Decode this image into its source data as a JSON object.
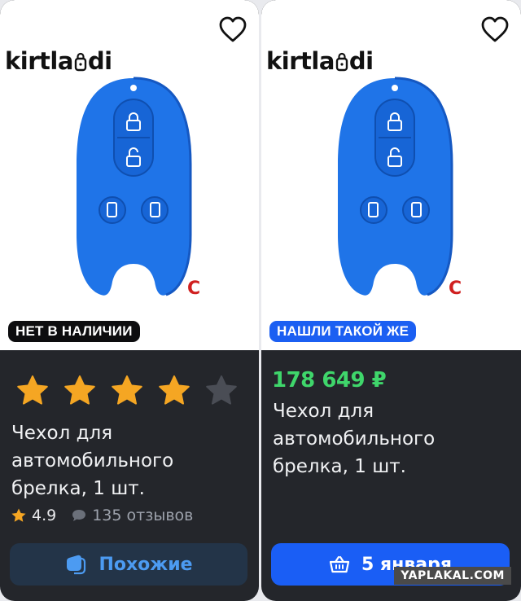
{
  "cards": [
    {
      "brand": "kirtlandi",
      "badge": "НЕТ В НАЛИЧИИ",
      "rating_stars": 4,
      "title": "Чехол для автомобильного брелка, 1 шт.",
      "rating": "4.9",
      "reviews": "135 отзывов",
      "button": "Похожие",
      "mark": "C"
    },
    {
      "brand": "kirtlandi",
      "badge": "НАШЛИ ТАКОЙ ЖЕ",
      "price": "178 649 ₽",
      "title": "Чехол для автомобильного брелка, 1 шт.",
      "button": "5 января",
      "mark": "C"
    }
  ],
  "colors": {
    "card_bg": "#24262b",
    "price_green": "#3fd66b",
    "star_orange": "#f5a623",
    "star_grey": "#4a4d55",
    "accent_blue": "#1a5ef5",
    "fob_blue": "#1f74e8"
  },
  "icons": [
    "heart-icon",
    "star-icon",
    "chat-icon",
    "similar-icon",
    "basket-icon",
    "lock-icon"
  ],
  "watermark": "YAPLAKAL.COM"
}
